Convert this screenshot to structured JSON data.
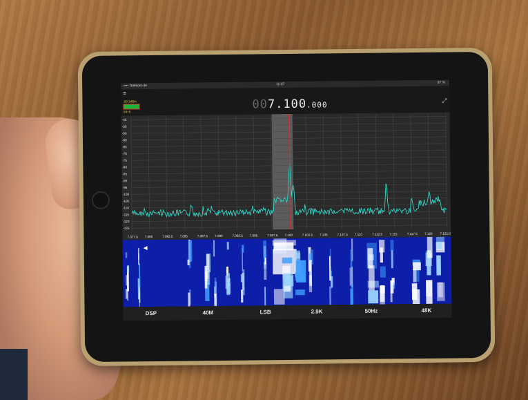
{
  "status_bar": {
    "carrier": "•••• Telekom.de",
    "time": "11:07",
    "battery": "97 %"
  },
  "toolbar": {
    "signal_dbm": "-93.3dBm",
    "s_meter_label": "S9+5",
    "frequency_dim": "00",
    "frequency_main": "7.100",
    "frequency_small": ".000"
  },
  "spectrum": {
    "y_ticks": [
      "-45",
      "-50",
      "-55",
      "-60",
      "-65",
      "-70",
      "-75",
      "-80",
      "-85",
      "-90",
      "-95",
      "-100",
      "-105",
      "-110",
      "-115",
      "-120",
      "-125"
    ],
    "x_ticks": [
      "7.077.5",
      "7.080",
      "7.082.5",
      "7.085",
      "7.087.5",
      "7.090",
      "7.092.5",
      "7.095",
      "7.097.5",
      "7.100",
      "7.102.5",
      "7.105",
      "7.107.5",
      "7.110",
      "7.112.5",
      "7.115",
      "7.117.5",
      "7.120",
      "7.122.5"
    ]
  },
  "bottom_bar": {
    "items": [
      {
        "label": "DSP"
      },
      {
        "label": "40M"
      },
      {
        "label": "LSB"
      },
      {
        "label": "2.9K"
      },
      {
        "label": "50Hz"
      },
      {
        "label": "48K"
      }
    ]
  },
  "colors": {
    "trace": "#2fd6c6",
    "tuning_line": "#e03030",
    "waterfall_bg": "#0d1ea8"
  }
}
